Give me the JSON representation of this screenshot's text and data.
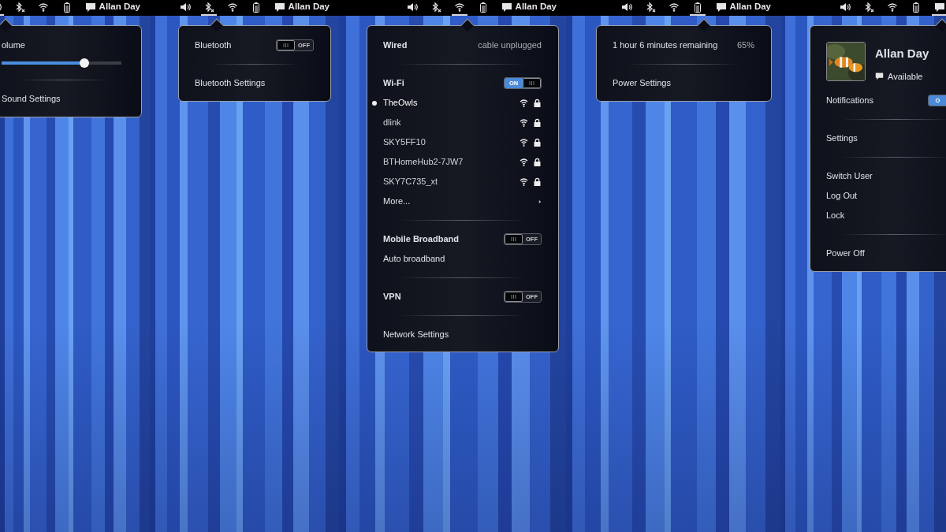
{
  "panels": [
    {
      "topbar": {
        "indicators": [
          {
            "kind": "volume",
            "selected": true
          },
          {
            "kind": "bluetooth",
            "selected": false
          },
          {
            "kind": "wifi",
            "selected": false
          },
          {
            "kind": "battery",
            "selected": false
          }
        ],
        "user": {
          "name": "Allan Day",
          "selected": false
        }
      },
      "menu": [
        {
          "kind": "item",
          "label": "olume"
        },
        {
          "kind": "slider",
          "level": 0.69
        },
        {
          "kind": "separator"
        },
        {
          "kind": "link",
          "label": "Sound Settings"
        }
      ]
    },
    {
      "topbar": {
        "indicators": [
          {
            "kind": "volume",
            "selected": false
          },
          {
            "kind": "bluetooth",
            "selected": true
          },
          {
            "kind": "wifi",
            "selected": false
          },
          {
            "kind": "battery",
            "selected": false
          }
        ],
        "user": {
          "name": "Allan Day",
          "selected": false
        }
      },
      "menu": [
        {
          "kind": "item",
          "label": "Bluetooth",
          "toggle": {
            "on": false,
            "text": "OFF"
          }
        },
        {
          "kind": "separator"
        },
        {
          "kind": "link",
          "label": "Bluetooth Settings"
        }
      ]
    },
    {
      "topbar": {
        "indicators": [
          {
            "kind": "volume",
            "selected": false
          },
          {
            "kind": "bluetooth",
            "selected": false
          },
          {
            "kind": "wifi",
            "selected": true
          },
          {
            "kind": "battery",
            "selected": false
          }
        ],
        "user": {
          "name": "Allan Day",
          "selected": false
        }
      },
      "menu": [
        {
          "kind": "heading",
          "label": "Wired",
          "value": "cable unplugged"
        },
        {
          "kind": "separator"
        },
        {
          "kind": "heading",
          "label": "Wi-Fi",
          "toggle": {
            "on": true,
            "text": "ON"
          }
        },
        {
          "kind": "network",
          "label": "TheOwls",
          "selected": true
        },
        {
          "kind": "network",
          "label": "dlink",
          "selected": false
        },
        {
          "kind": "network",
          "label": "SKY5FF10",
          "selected": false
        },
        {
          "kind": "network",
          "label": "BTHomeHub2-7JW7",
          "selected": false
        },
        {
          "kind": "network",
          "label": "SKY7C735_xt",
          "selected": false
        },
        {
          "kind": "more",
          "label": "More..."
        },
        {
          "kind": "separator"
        },
        {
          "kind": "heading",
          "label": "Mobile Broadband",
          "toggle": {
            "on": false,
            "text": "OFF"
          }
        },
        {
          "kind": "link",
          "label": "Auto broadband"
        },
        {
          "kind": "separator"
        },
        {
          "kind": "heading",
          "label": "VPN",
          "toggle": {
            "on": false,
            "text": "OFF"
          }
        },
        {
          "kind": "separator"
        },
        {
          "kind": "link",
          "label": "Network Settings"
        }
      ]
    },
    {
      "topbar": {
        "indicators": [
          {
            "kind": "volume",
            "selected": false
          },
          {
            "kind": "bluetooth",
            "selected": false
          },
          {
            "kind": "wifi",
            "selected": false
          },
          {
            "kind": "battery",
            "selected": true
          }
        ],
        "user": {
          "name": "Allan Day",
          "selected": false
        }
      },
      "menu": [
        {
          "kind": "item",
          "label": "1 hour 6 minutes remaining",
          "value": "65%"
        },
        {
          "kind": "separator"
        },
        {
          "kind": "link",
          "label": "Power Settings"
        }
      ]
    },
    {
      "topbar": {
        "indicators": [
          {
            "kind": "volume",
            "selected": false
          },
          {
            "kind": "bluetooth",
            "selected": false
          },
          {
            "kind": "wifi",
            "selected": false
          },
          {
            "kind": "battery",
            "selected": false
          }
        ],
        "user": {
          "selected": true
        }
      },
      "menu": [
        {
          "kind": "profile",
          "name": "Allan Day",
          "status": "Available"
        },
        {
          "kind": "item",
          "label": "Notifications",
          "toggle": {
            "on": true,
            "text": "O"
          }
        },
        {
          "kind": "separator"
        },
        {
          "kind": "link",
          "label": "Settings"
        },
        {
          "kind": "separator"
        },
        {
          "kind": "link",
          "label": "Switch User"
        },
        {
          "kind": "link",
          "label": "Log Out"
        },
        {
          "kind": "link",
          "label": "Lock"
        },
        {
          "kind": "separator"
        },
        {
          "kind": "link",
          "label": "Power Off"
        }
      ]
    }
  ]
}
